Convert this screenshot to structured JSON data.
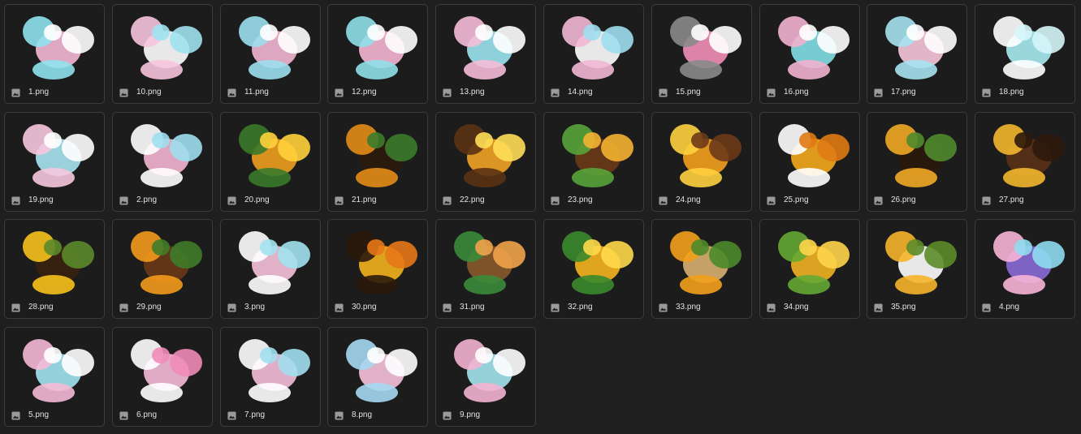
{
  "files": [
    {
      "name": "1.png",
      "palette": [
        "#f6b9d6",
        "#8fe3ee",
        "#ffffff"
      ]
    },
    {
      "name": "10.png",
      "palette": [
        "#ffffff",
        "#f7c4dc",
        "#9ee2f0"
      ]
    },
    {
      "name": "11.png",
      "palette": [
        "#f3b7d4",
        "#9ce0ee",
        "#ffffff"
      ]
    },
    {
      "name": "12.png",
      "palette": [
        "#f7b6d3",
        "#8fe0e9",
        "#ffffff"
      ]
    },
    {
      "name": "13.png",
      "palette": [
        "#9be5ef",
        "#f6bcd8",
        "#ffffff"
      ]
    },
    {
      "name": "14.png",
      "palette": [
        "#ffffff",
        "#f2b7d3",
        "#9edfee"
      ]
    },
    {
      "name": "15.png",
      "palette": [
        "#f38fb8",
        "#8a8a8a",
        "#ffffff"
      ]
    },
    {
      "name": "16.png",
      "palette": [
        "#82dfe6",
        "#f3b1cf",
        "#ffffff"
      ]
    },
    {
      "name": "17.png",
      "palette": [
        "#f8c6dd",
        "#a6e3f0",
        "#ffffff"
      ]
    },
    {
      "name": "18.png",
      "palette": [
        "#a9ecf3",
        "#ffffff",
        "#d6f6fa"
      ]
    },
    {
      "name": "19.png",
      "palette": [
        "#a8e6f2",
        "#f7c7de",
        "#ffffff"
      ]
    },
    {
      "name": "2.png",
      "palette": [
        "#f6b6d3",
        "#ffffff",
        "#9edfee"
      ]
    },
    {
      "name": "20.png",
      "palette": [
        "#f0a020",
        "#3a7a2a",
        "#ffd23a"
      ]
    },
    {
      "name": "21.png",
      "palette": [
        "#2c1b0d",
        "#e38d17",
        "#3b7b2c"
      ]
    },
    {
      "name": "22.png",
      "palette": [
        "#f0a325",
        "#5a3214",
        "#ffde58"
      ]
    },
    {
      "name": "23.png",
      "palette": [
        "#6b3a18",
        "#58a43a",
        "#f3b331"
      ]
    },
    {
      "name": "24.png",
      "palette": [
        "#f4a01f",
        "#ffd13e",
        "#6b3a18"
      ]
    },
    {
      "name": "25.png",
      "palette": [
        "#f4a81c",
        "#ffffff",
        "#e07a14"
      ]
    },
    {
      "name": "26.png",
      "palette": [
        "#2b1a0c",
        "#f0a826",
        "#4f8b2c"
      ]
    },
    {
      "name": "27.png",
      "palette": [
        "#5a3218",
        "#f3b72e",
        "#2e1a0c"
      ]
    },
    {
      "name": "28.png",
      "palette": [
        "#3a2210",
        "#f6c21c",
        "#5b8a2b"
      ]
    },
    {
      "name": "29.png",
      "palette": [
        "#6b3918",
        "#f39a1c",
        "#3f7c2a"
      ]
    },
    {
      "name": "3.png",
      "palette": [
        "#f7c2dc",
        "#ffffff",
        "#a2e2f0"
      ]
    },
    {
      "name": "30.png",
      "palette": [
        "#f4b21d",
        "#2b1a0c",
        "#e57817"
      ]
    },
    {
      "name": "31.png",
      "palette": [
        "#8a5a2b",
        "#3b8b3a",
        "#f0a34a"
      ]
    },
    {
      "name": "32.png",
      "palette": [
        "#f6b520",
        "#3a8a2c",
        "#ffd94a"
      ]
    },
    {
      "name": "33.png",
      "palette": [
        "#d9b070",
        "#f2a01c",
        "#4b8a2b"
      ]
    },
    {
      "name": "34.png",
      "palette": [
        "#f0b324",
        "#64a834",
        "#ffd54a"
      ]
    },
    {
      "name": "35.png",
      "palette": [
        "#ffffff",
        "#f6b52a",
        "#5c8c2a"
      ]
    },
    {
      "name": "4.png",
      "palette": [
        "#8a6bd8",
        "#f7b4d6",
        "#8fdcef"
      ]
    },
    {
      "name": "5.png",
      "palette": [
        "#a3e5f2",
        "#f6b9d6",
        "#ffffff"
      ]
    },
    {
      "name": "6.png",
      "palette": [
        "#f6bcd8",
        "#ffffff",
        "#f08cb8"
      ]
    },
    {
      "name": "7.png",
      "palette": [
        "#f6c0da",
        "#ffffff",
        "#a2dff0"
      ]
    },
    {
      "name": "8.png",
      "palette": [
        "#f7c2dc",
        "#a5d9f2",
        "#ffffff"
      ]
    },
    {
      "name": "9.png",
      "palette": [
        "#a4e6ef",
        "#f4b3d0",
        "#ffffff"
      ]
    }
  ]
}
